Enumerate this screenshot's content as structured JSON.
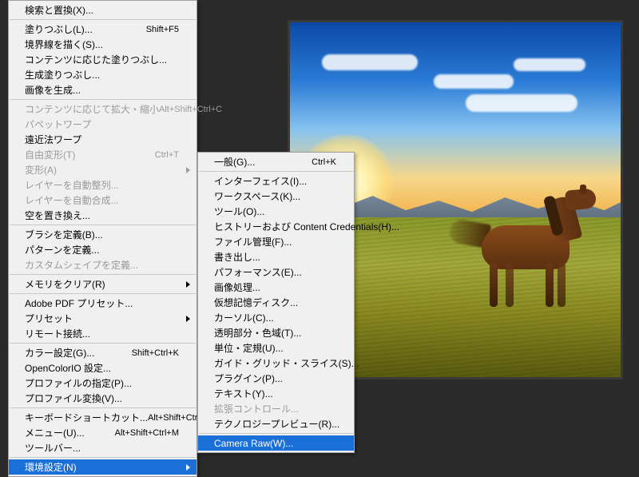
{
  "menu_main": {
    "items": [
      {
        "label": "検索と置換(X)...",
        "shortcut": "",
        "enabled": true,
        "sub": false,
        "sep": true,
        "truncated_top": true
      },
      {
        "label": "塗りつぶし(L)...",
        "shortcut": "Shift+F5",
        "enabled": true,
        "sub": false
      },
      {
        "label": "境界線を描く(S)...",
        "shortcut": "",
        "enabled": true,
        "sub": false
      },
      {
        "label": "コンテンツに応じた塗りつぶし...",
        "shortcut": "",
        "enabled": true,
        "sub": false
      },
      {
        "label": "生成塗りつぶし...",
        "shortcut": "",
        "enabled": true,
        "sub": false
      },
      {
        "label": "画像を生成...",
        "shortcut": "",
        "enabled": true,
        "sub": false,
        "sep": true
      },
      {
        "label": "コンテンツに応じて拡大・縮小",
        "shortcut": "Alt+Shift+Ctrl+C",
        "enabled": false,
        "sub": false
      },
      {
        "label": "パペットワープ",
        "shortcut": "",
        "enabled": false,
        "sub": false
      },
      {
        "label": "遠近法ワープ",
        "shortcut": "",
        "enabled": true,
        "sub": false
      },
      {
        "label": "自由変形(T)",
        "shortcut": "Ctrl+T",
        "enabled": false,
        "sub": false
      },
      {
        "label": "変形(A)",
        "shortcut": "",
        "enabled": false,
        "sub": true
      },
      {
        "label": "レイヤーを自動整列...",
        "shortcut": "",
        "enabled": false,
        "sub": false
      },
      {
        "label": "レイヤーを自動合成...",
        "shortcut": "",
        "enabled": false,
        "sub": false
      },
      {
        "label": "空を置き換え...",
        "shortcut": "",
        "enabled": true,
        "sub": false,
        "sep": true
      },
      {
        "label": "ブラシを定義(B)...",
        "shortcut": "",
        "enabled": true,
        "sub": false
      },
      {
        "label": "パターンを定義...",
        "shortcut": "",
        "enabled": true,
        "sub": false
      },
      {
        "label": "カスタムシェイプを定義...",
        "shortcut": "",
        "enabled": false,
        "sub": false,
        "sep": true
      },
      {
        "label": "メモリをクリア(R)",
        "shortcut": "",
        "enabled": true,
        "sub": true,
        "sep": true
      },
      {
        "label": "Adobe PDF プリセット...",
        "shortcut": "",
        "enabled": true,
        "sub": false
      },
      {
        "label": "プリセット",
        "shortcut": "",
        "enabled": true,
        "sub": true
      },
      {
        "label": "リモート接続...",
        "shortcut": "",
        "enabled": true,
        "sub": false,
        "sep": true
      },
      {
        "label": "カラー設定(G)...",
        "shortcut": "Shift+Ctrl+K",
        "enabled": true,
        "sub": false
      },
      {
        "label": "OpenColorIO 設定...",
        "shortcut": "",
        "enabled": true,
        "sub": false
      },
      {
        "label": "プロファイルの指定(P)...",
        "shortcut": "",
        "enabled": true,
        "sub": false
      },
      {
        "label": "プロファイル変換(V)...",
        "shortcut": "",
        "enabled": true,
        "sub": false,
        "sep": true
      },
      {
        "label": "キーボードショートカット...",
        "shortcut": "Alt+Shift+Ctrl+K",
        "enabled": true,
        "sub": false
      },
      {
        "label": "メニュー(U)...",
        "shortcut": "Alt+Shift+Ctrl+M",
        "enabled": true,
        "sub": false
      },
      {
        "label": "ツールバー...",
        "shortcut": "",
        "enabled": true,
        "sub": false,
        "sep": true
      },
      {
        "label": "環境設定(N)",
        "shortcut": "",
        "enabled": true,
        "sub": true,
        "highlight": true
      }
    ]
  },
  "menu_sub": {
    "items": [
      {
        "label": "一般(G)...",
        "shortcut": "Ctrl+K",
        "enabled": true,
        "sep": true
      },
      {
        "label": "インターフェイス(I)...",
        "shortcut": "",
        "enabled": true
      },
      {
        "label": "ワークスペース(K)...",
        "shortcut": "",
        "enabled": true
      },
      {
        "label": "ツール(O)...",
        "shortcut": "",
        "enabled": true
      },
      {
        "label": "ヒストリーおよび Content Credentials(H)...",
        "shortcut": "",
        "enabled": true
      },
      {
        "label": "ファイル管理(F)...",
        "shortcut": "",
        "enabled": true
      },
      {
        "label": "書き出し...",
        "shortcut": "",
        "enabled": true
      },
      {
        "label": "パフォーマンス(E)...",
        "shortcut": "",
        "enabled": true
      },
      {
        "label": "画像処理...",
        "shortcut": "",
        "enabled": true
      },
      {
        "label": "仮想記憶ディスク...",
        "shortcut": "",
        "enabled": true
      },
      {
        "label": "カーソル(C)...",
        "shortcut": "",
        "enabled": true
      },
      {
        "label": "透明部分・色域(T)...",
        "shortcut": "",
        "enabled": true
      },
      {
        "label": "単位・定規(U)...",
        "shortcut": "",
        "enabled": true
      },
      {
        "label": "ガイド・グリッド・スライス(S)...",
        "shortcut": "",
        "enabled": true
      },
      {
        "label": "プラグイン(P)...",
        "shortcut": "",
        "enabled": true
      },
      {
        "label": "テキスト(Y)...",
        "shortcut": "",
        "enabled": true
      },
      {
        "label": "拡張コントロール...",
        "shortcut": "",
        "enabled": false
      },
      {
        "label": "テクノロジープレビュー(R)...",
        "shortcut": "",
        "enabled": true,
        "sep": true
      },
      {
        "label": "Camera Raw(W)...",
        "shortcut": "",
        "enabled": true,
        "highlight": true
      }
    ]
  },
  "image": {
    "description": "Horse standing in golden grass field at sunset with blue sky, clouds and mountains"
  }
}
